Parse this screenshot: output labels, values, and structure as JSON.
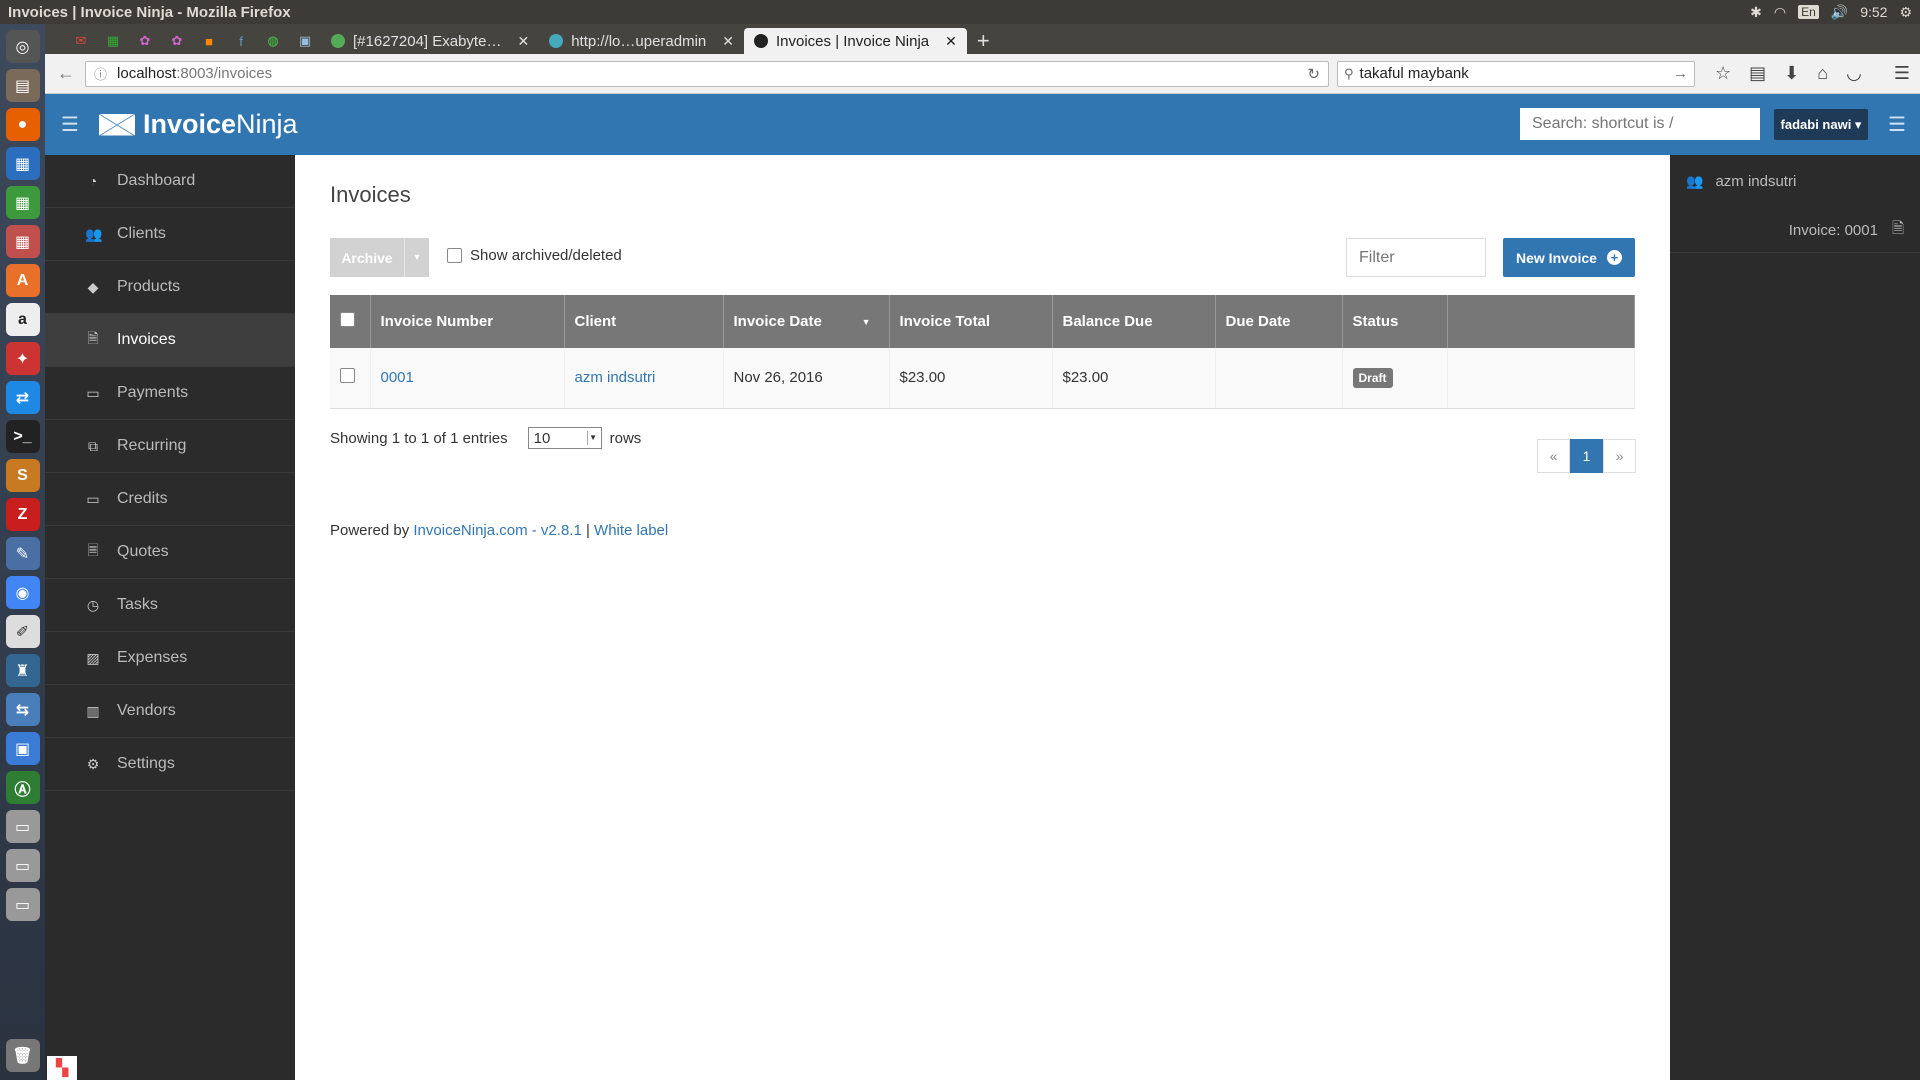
{
  "os": {
    "window_title": "Invoices | Invoice Ninja - Mozilla Firefox",
    "lang": "En",
    "time": "9:52"
  },
  "browser": {
    "tabs": [
      {
        "label": "[#1627204] Exabyte…"
      },
      {
        "label": "http://lo…uperadmin"
      },
      {
        "label": "Invoices | Invoice Ninja"
      }
    ],
    "url_host": "localhost",
    "url_path": ":8003/invoices",
    "search_value": "takaful maybank"
  },
  "header": {
    "logo_bold": "Invoice",
    "logo_light": "Ninja",
    "search_placeholder": "Search: shortcut is /",
    "user_label": "fadabi nawi ▾"
  },
  "sidebar": {
    "items": [
      {
        "label": "Dashboard",
        "icon": "dashboard-icon"
      },
      {
        "label": "Clients",
        "icon": "users-icon"
      },
      {
        "label": "Products",
        "icon": "cube-icon"
      },
      {
        "label": "Invoices",
        "icon": "file-pdf-icon"
      },
      {
        "label": "Payments",
        "icon": "credit-card-icon"
      },
      {
        "label": "Recurring",
        "icon": "files-icon"
      },
      {
        "label": "Credits",
        "icon": "credit-card-icon"
      },
      {
        "label": "Quotes",
        "icon": "file-text-icon"
      },
      {
        "label": "Tasks",
        "icon": "clock-icon"
      },
      {
        "label": "Expenses",
        "icon": "image-icon"
      },
      {
        "label": "Vendors",
        "icon": "building-icon"
      },
      {
        "label": "Settings",
        "icon": "gear-icon"
      }
    ]
  },
  "main": {
    "title": "Invoices",
    "archive_label": "Archive",
    "show_archived_label": "Show archived/deleted",
    "filter_placeholder": "Filter",
    "new_invoice_label": "New Invoice",
    "columns": [
      "Invoice Number",
      "Client",
      "Invoice Date",
      "Invoice Total",
      "Balance Due",
      "Due Date",
      "Status"
    ],
    "rows": [
      {
        "number": "0001",
        "client": "azm indsutri",
        "date": "Nov 26, 2016",
        "total": "$23.00",
        "balance": "$23.00",
        "due": "",
        "status": "Draft"
      }
    ],
    "showing_text": "Showing 1 to 1 of 1 entries",
    "rows_value": "10",
    "rows_label": "rows",
    "pager": {
      "prev": "«",
      "current": "1",
      "next": "»"
    },
    "powered_prefix": "Powered by ",
    "powered_link": "InvoiceNinja.com - v2.8.1",
    "powered_sep": " | ",
    "white_label": "White label"
  },
  "right_panel": {
    "client": "azm indsutri",
    "invoice": "Invoice: 0001"
  }
}
